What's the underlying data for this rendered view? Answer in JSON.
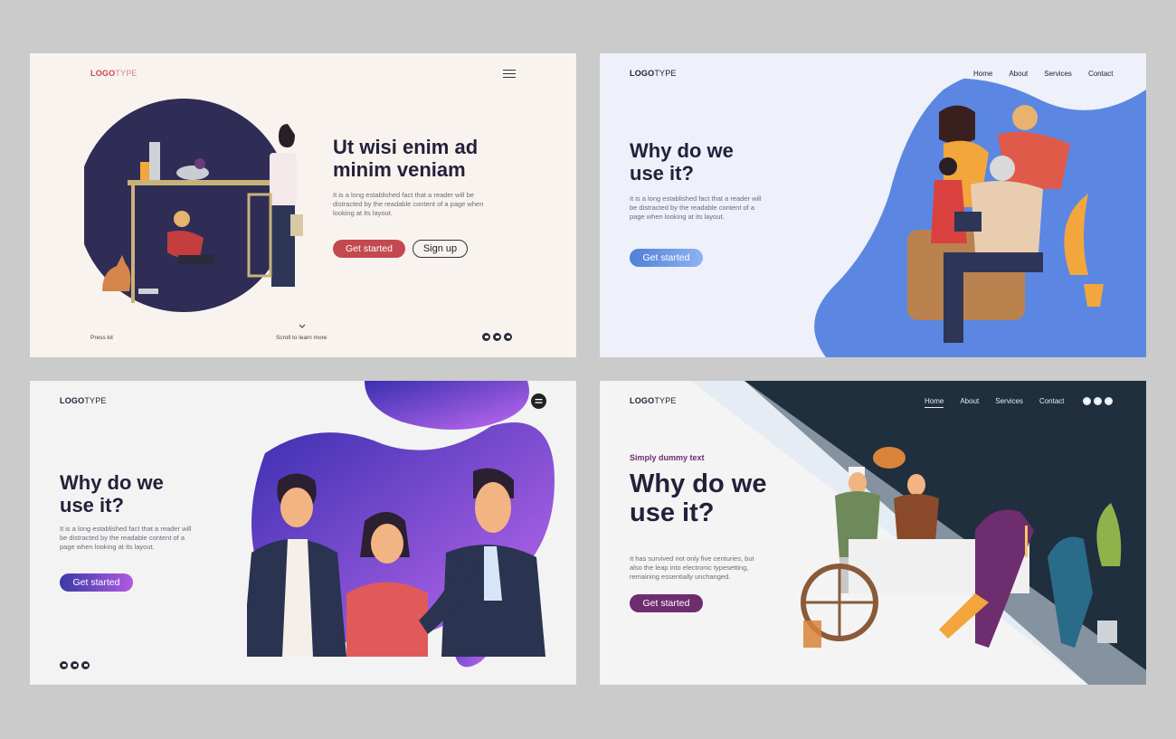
{
  "card1": {
    "logo": {
      "bold": "LOGO",
      "light": "TYPE"
    },
    "title_line1": "Ut wisi enim ad",
    "title_line2": "minim veniam",
    "body_line1": "It is a long established fact that a reader will be",
    "body_line2": "distracted by the readable content of a page when",
    "body_line3": "looking at its layout.",
    "primary_button": "Get started",
    "secondary_button": "Sign up",
    "footer_left": "Press kit",
    "footer_center": "Scroll to learn more",
    "colors": {
      "button": "#c4494f",
      "logo_bold": "#c4494f",
      "circle": "#2f2d55"
    }
  },
  "card2": {
    "logo": {
      "bold": "LOGO",
      "light": "TYPE"
    },
    "nav": [
      "Home",
      "About",
      "Services",
      "Contact"
    ],
    "title_line1": "Why do we",
    "title_line2": "use it?",
    "body_line1": "It is a long established fact that a reader will",
    "body_line2": "be distracted by the readable content of a",
    "body_line3": "page when looking at its layout.",
    "primary_button": "Get started",
    "colors": {
      "button": "#5b8fe0",
      "blob": "#4a7be0"
    }
  },
  "card3": {
    "logo": {
      "bold": "LOGO",
      "light": "TYPE"
    },
    "title_line1": "Why do we",
    "title_line2": "use it?",
    "body_line1": "It is a long established fact that a reader will",
    "body_line2": "be distracted by the readable content of a",
    "body_line3": "page when looking at its layout.",
    "primary_button": "Get started",
    "colors": {
      "button_from": "#3a3aa8",
      "button_to": "#b05ae0",
      "blob": "#7a3ee0"
    }
  },
  "card4": {
    "logo": {
      "bold": "LOGO",
      "light": "TYPE"
    },
    "nav": [
      "Home",
      "About",
      "Services",
      "Contact"
    ],
    "kicker": "Simply dummy text",
    "title_line1": "Why do we",
    "title_line2": "use it?",
    "body_line1": "It has survived not only five centuries, but",
    "body_line2": "also the leap into electronic typesetting,",
    "body_line3": "remaining essentially unchanged.",
    "primary_button": "Get started",
    "colors": {
      "button": "#6e2d6e",
      "dark_panel": "#1f2f3d",
      "kicker": "#6e2d6e"
    }
  }
}
